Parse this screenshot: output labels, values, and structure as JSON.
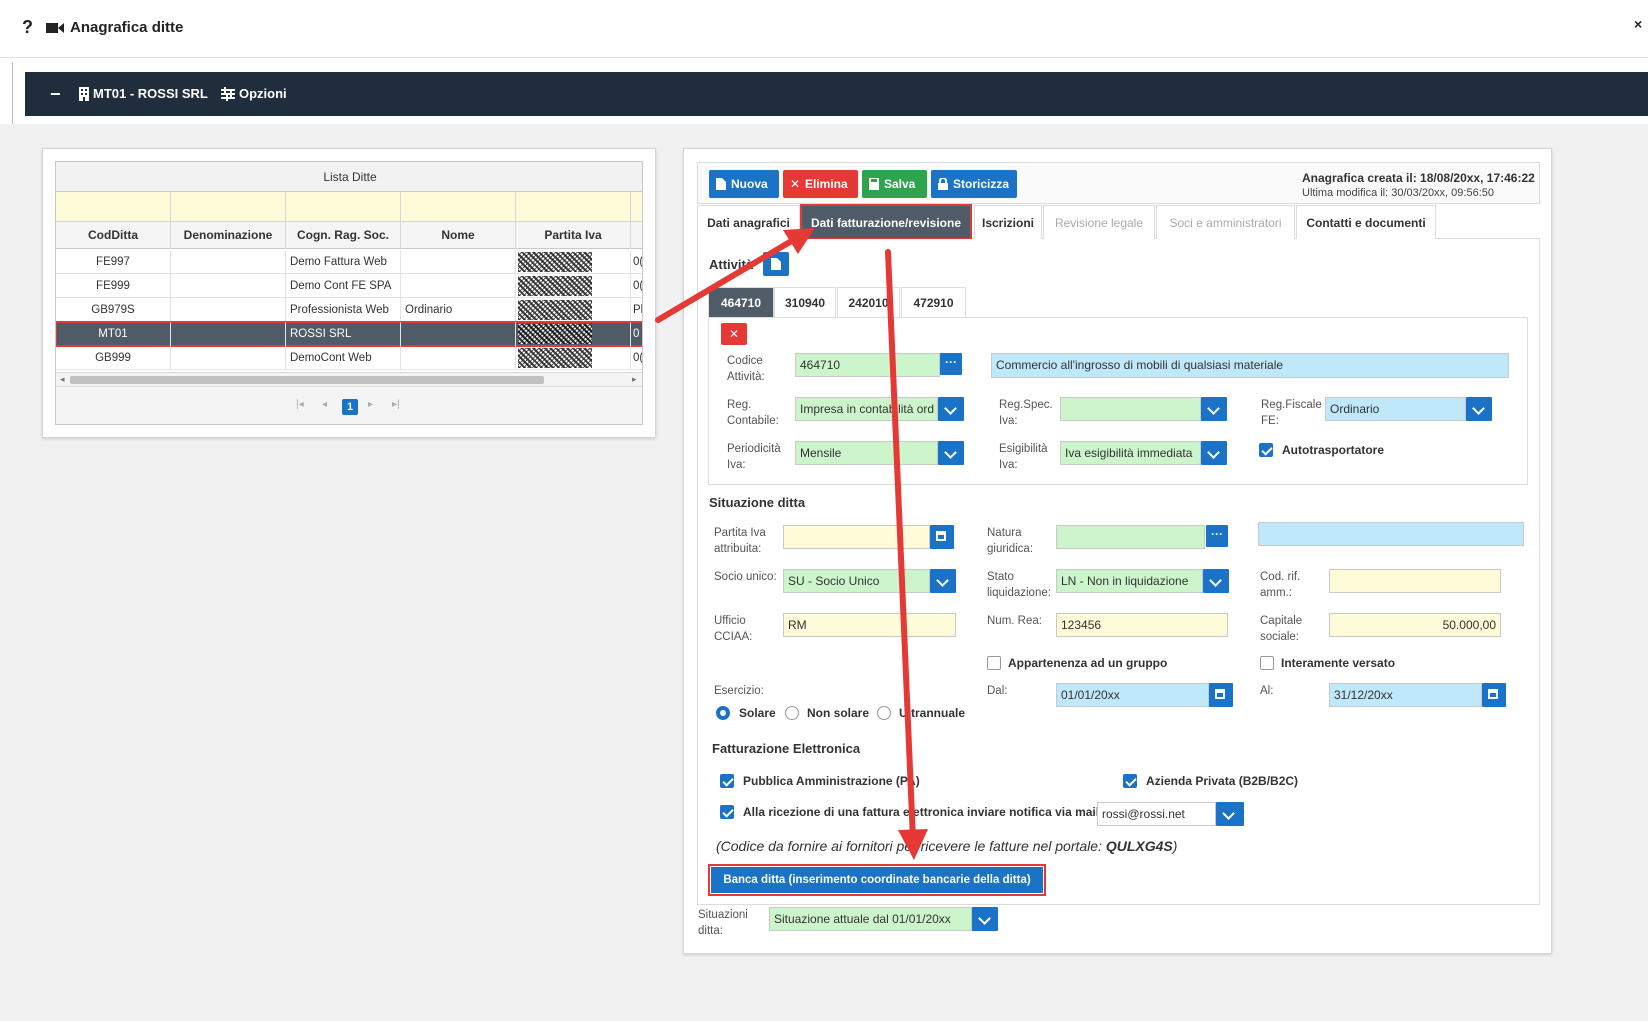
{
  "header": {
    "help": "?",
    "title": "Anagrafica ditte",
    "close": "×"
  },
  "company_bar": {
    "company": "MT01 - ROSSI SRL",
    "options": "Opzioni"
  },
  "grid": {
    "title": "Lista Ditte",
    "columns": [
      "CodDitta",
      "Denominazione",
      "Cogn. Rag. Soc.",
      "Nome",
      "Partita Iva"
    ],
    "rows": [
      {
        "cod": "FE997",
        "den": "",
        "rag": "Demo Fattura Web",
        "nome": "",
        "piva_tail": "0("
      },
      {
        "cod": "FE999",
        "den": "",
        "rag": "Demo Cont FE SPA",
        "nome": "",
        "piva_tail": "0("
      },
      {
        "cod": "GB979S",
        "den": "",
        "rag": "Professionista Web",
        "nome": "Ordinario",
        "piva_tail": "Pl"
      },
      {
        "cod": "MT01",
        "den": "",
        "rag": "ROSSI SRL",
        "nome": "",
        "piva_tail": "0"
      },
      {
        "cod": "GB999",
        "den": "",
        "rag": "DemoCont Web",
        "nome": "",
        "piva_tail": "0("
      }
    ],
    "page": "1"
  },
  "toolbar": {
    "nuova": "Nuova",
    "elimina": "Elimina",
    "salva": "Salva",
    "storicizza": "Storicizza",
    "created": "Anagrafica creata il: 18/08/20xx, 17:46:22",
    "modified": "Ultima modifica il: 30/03/20xx, 09:56:50"
  },
  "tabs": [
    "Dati anagrafici",
    "Dati fatturazione/revisione",
    "Iscrizioni",
    "Revisione legale",
    "Soci e amministratori",
    "Contatti e documenti"
  ],
  "attivita": {
    "label": "Attività",
    "subtabs": [
      "464710",
      "310940",
      "242010",
      "472910"
    ],
    "codice_label": "Codice Attività:",
    "codice_value": "464710",
    "descrizione": "Commercio all'ingrosso di mobili di qualsiasi materiale",
    "reg_contabile_label": "Reg. Contabile:",
    "reg_contabile": "Impresa in contabilità ord",
    "reg_spec_label": "Reg.Spec. Iva:",
    "reg_spec": "",
    "reg_fiscale_label": "Reg.Fiscale FE:",
    "reg_fiscale": "Ordinario",
    "periodicita_label": "Periodicità Iva:",
    "periodicita": "Mensile",
    "esigibilita_label": "Esigibilità Iva:",
    "esigibilita": "Iva esigibilità immediata",
    "autotrasportatore": "Autotrasportatore"
  },
  "situazione": {
    "title": "Situazione ditta",
    "piva_attr_label": "Partita Iva attribuita:",
    "natura_label": "Natura giuridica:",
    "socio_label": "Socio unico:",
    "socio": "SU - Socio Unico",
    "stato_label": "Stato liquidazione:",
    "stato": "LN - Non in liquidazione",
    "codrif_label": "Cod. rif. amm.:",
    "ufficio_label": "Ufficio CCIAA:",
    "ufficio": "RM",
    "numrea_label": "Num. Rea:",
    "numrea": "123456",
    "capitale_label": "Capitale sociale:",
    "capitale": "50.000,00",
    "gruppo": "Appartenenza ad un gruppo",
    "versato": "Interamente versato",
    "esercizio_label": "Esercizio:",
    "solare": "Solare",
    "non_solare": "Non solare",
    "ultrannuale": "Ultrannuale",
    "dal_label": "Dal:",
    "dal": "01/01/20xx",
    "al_label": "Al:",
    "al": "31/12/20xx"
  },
  "fatturazione": {
    "title": "Fatturazione Elettronica",
    "pa": "Pubblica Amministrazione (PA)",
    "b2b": "Azienda Privata (B2B/B2C)",
    "notifica": "Alla ricezione di una fattura elettronica inviare notifica via mail a",
    "email": "rossi@rossi.net",
    "codice_note": "(Codice da fornire ai fornitori per ricevere le fatture nel portale: ",
    "codice": "QULXG4S",
    "codice_close": ")",
    "banca": "Banca ditta (inserimento coordinate bancarie della ditta)"
  },
  "situazioni": {
    "label": "Situazioni ditta:",
    "value": "Situazione attuale dal 01/01/20xx"
  },
  "colors": {
    "accent": "#1a73c7",
    "danger": "#e53935",
    "success": "#2ea44f",
    "dark": "#1f2d3d"
  }
}
